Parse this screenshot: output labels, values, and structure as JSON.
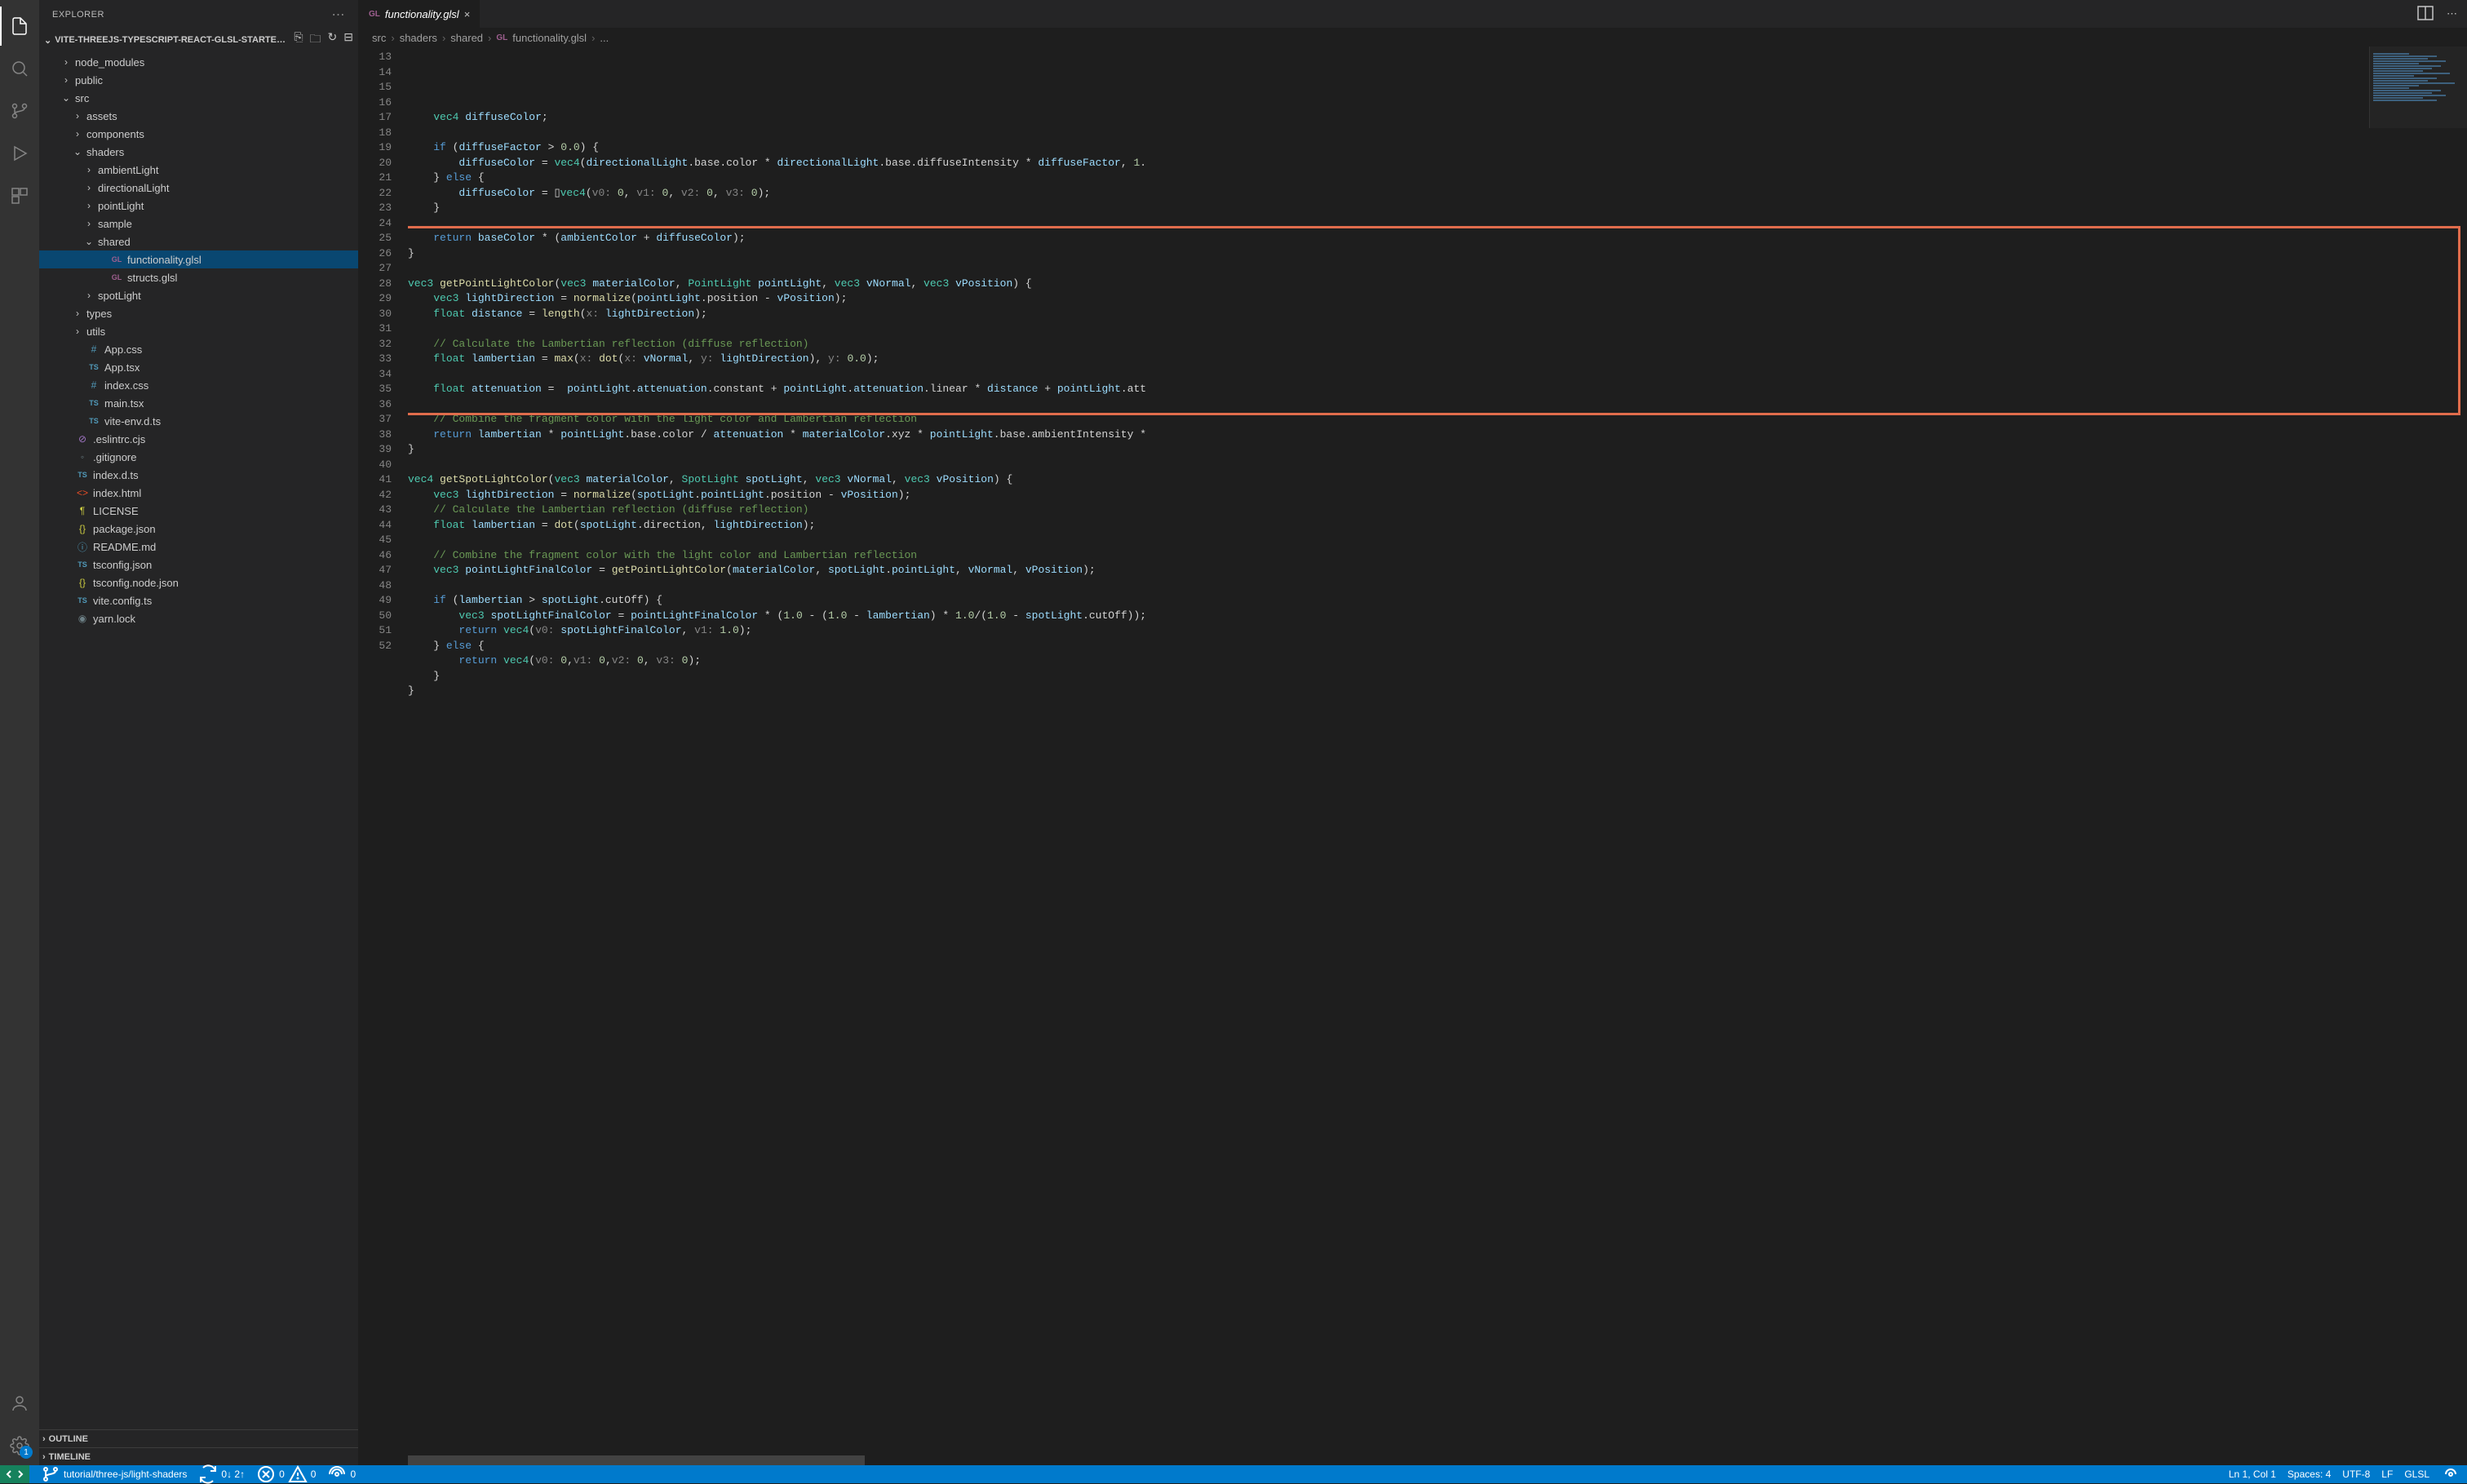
{
  "sidebar": {
    "title": "EXPLORER",
    "project": "VITE-THREEJS-TYPESCRIPT-REACT-GLSL-STARTER-...",
    "outline": "OUTLINE",
    "timeline": "TIMELINE"
  },
  "tree": [
    {
      "depth": 1,
      "chev": "›",
      "icon": "",
      "label": "node_modules",
      "kind": "folder"
    },
    {
      "depth": 1,
      "chev": "›",
      "icon": "",
      "label": "public",
      "kind": "folder"
    },
    {
      "depth": 1,
      "chev": "⌄",
      "icon": "",
      "label": "src",
      "kind": "folder"
    },
    {
      "depth": 2,
      "chev": "›",
      "icon": "",
      "label": "assets",
      "kind": "folder"
    },
    {
      "depth": 2,
      "chev": "›",
      "icon": "",
      "label": "components",
      "kind": "folder"
    },
    {
      "depth": 2,
      "chev": "⌄",
      "icon": "",
      "label": "shaders",
      "kind": "folder"
    },
    {
      "depth": 3,
      "chev": "›",
      "icon": "",
      "label": "ambientLight",
      "kind": "folder"
    },
    {
      "depth": 3,
      "chev": "›",
      "icon": "",
      "label": "directionalLight",
      "kind": "folder"
    },
    {
      "depth": 3,
      "chev": "›",
      "icon": "",
      "label": "pointLight",
      "kind": "folder"
    },
    {
      "depth": 3,
      "chev": "›",
      "icon": "",
      "label": "sample",
      "kind": "folder"
    },
    {
      "depth": 3,
      "chev": "⌄",
      "icon": "",
      "label": "shared",
      "kind": "folder"
    },
    {
      "depth": 4,
      "chev": "",
      "icon": "GL",
      "label": "functionality.glsl",
      "kind": "file",
      "selected": true
    },
    {
      "depth": 4,
      "chev": "",
      "icon": "GL",
      "label": "structs.glsl",
      "kind": "file"
    },
    {
      "depth": 3,
      "chev": "›",
      "icon": "",
      "label": "spotLight",
      "kind": "folder"
    },
    {
      "depth": 2,
      "chev": "›",
      "icon": "",
      "label": "types",
      "kind": "folder"
    },
    {
      "depth": 2,
      "chev": "›",
      "icon": "",
      "label": "utils",
      "kind": "folder"
    },
    {
      "depth": 2,
      "chev": "",
      "icon": "#",
      "label": "App.css",
      "kind": "file"
    },
    {
      "depth": 2,
      "chev": "",
      "icon": "TS",
      "label": "App.tsx",
      "kind": "file"
    },
    {
      "depth": 2,
      "chev": "",
      "icon": "#",
      "label": "index.css",
      "kind": "file"
    },
    {
      "depth": 2,
      "chev": "",
      "icon": "TS",
      "label": "main.tsx",
      "kind": "file"
    },
    {
      "depth": 2,
      "chev": "",
      "icon": "TS",
      "label": "vite-env.d.ts",
      "kind": "file"
    },
    {
      "depth": 1,
      "chev": "",
      "icon": "⊘",
      "label": ".eslintrc.cjs",
      "kind": "file"
    },
    {
      "depth": 1,
      "chev": "",
      "icon": "◦",
      "label": ".gitignore",
      "kind": "file"
    },
    {
      "depth": 1,
      "chev": "",
      "icon": "TS",
      "label": "index.d.ts",
      "kind": "file"
    },
    {
      "depth": 1,
      "chev": "",
      "icon": "<>",
      "label": "index.html",
      "kind": "file"
    },
    {
      "depth": 1,
      "chev": "",
      "icon": "¶",
      "label": "LICENSE",
      "kind": "file"
    },
    {
      "depth": 1,
      "chev": "",
      "icon": "{}",
      "label": "package.json",
      "kind": "file"
    },
    {
      "depth": 1,
      "chev": "",
      "icon": "ⓘ",
      "label": "README.md",
      "kind": "file"
    },
    {
      "depth": 1,
      "chev": "",
      "icon": "TS",
      "label": "tsconfig.json",
      "kind": "file"
    },
    {
      "depth": 1,
      "chev": "",
      "icon": "{}",
      "label": "tsconfig.node.json",
      "kind": "file"
    },
    {
      "depth": 1,
      "chev": "",
      "icon": "TS",
      "label": "vite.config.ts",
      "kind": "file"
    },
    {
      "depth": 1,
      "chev": "",
      "icon": "◉",
      "label": "yarn.lock",
      "kind": "file"
    }
  ],
  "tab": {
    "lang": "GL",
    "name": "functionality.glsl"
  },
  "breadcrumb": [
    "src",
    "shaders",
    "shared",
    "functionality.glsl",
    "..."
  ],
  "breadcrumbFileLang": "GL",
  "code": {
    "startLine": 13,
    "highlightStartLine": 25,
    "highlightEndLine": 36,
    "lines": [
      "",
      "    vec4 diffuseColor;",
      "",
      "    if (diffuseFactor > 0.0) {",
      "        diffuseColor = vec4(directionalLight.base.color * directionalLight.base.diffuseIntensity * diffuseFactor, 1.",
      "    } else {",
      "        diffuseColor = ▯vec4(v0: 0, v1: 0, v2: 0, v3: 0);",
      "    }",
      "",
      "    return baseColor * (ambientColor + diffuseColor);",
      "}",
      "",
      "vec3 getPointLightColor(vec3 materialColor, PointLight pointLight, vec3 vNormal, vec3 vPosition) {",
      "    vec3 lightDirection = normalize(pointLight.position - vPosition);",
      "    float distance = length(x: lightDirection);",
      "",
      "    // Calculate the Lambertian reflection (diffuse reflection)",
      "    float lambertian = max(x: dot(x: vNormal, y: lightDirection), y: 0.0);",
      "",
      "    float attenuation =  pointLight.attenuation.constant + pointLight.attenuation.linear * distance + pointLight.att",
      "",
      "    // Combine the fragment color with the light color and Lambertian reflection",
      "    return lambertian * pointLight.base.color / attenuation * materialColor.xyz * pointLight.base.ambientIntensity *",
      "}",
      "",
      "vec4 getSpotLightColor(vec3 materialColor, SpotLight spotLight, vec3 vNormal, vec3 vPosition) {",
      "    vec3 lightDirection = normalize(spotLight.pointLight.position - vPosition);",
      "    // Calculate the Lambertian reflection (diffuse reflection)",
      "    float lambertian = dot(spotLight.direction, lightDirection);",
      "",
      "    // Combine the fragment color with the light color and Lambertian reflection",
      "    vec3 pointLightFinalColor = getPointLightColor(materialColor, spotLight.pointLight, vNormal, vPosition);",
      "",
      "    if (lambertian > spotLight.cutOff) {",
      "        vec3 spotLightFinalColor = pointLightFinalColor * (1.0 - (1.0 - lambertian) * 1.0/(1.0 - spotLight.cutOff));",
      "        return vec4(v0: spotLightFinalColor, v1: 1.0);",
      "    } else {",
      "        return vec4(v0: 0,v1: 0,v2: 0, v3: 0);",
      "    }",
      "}"
    ]
  },
  "status": {
    "branch": "tutorial/three-js/light-shaders",
    "sync": "0↓ 2↑",
    "errors": "0",
    "warnings": "0",
    "radio": "0",
    "cursor": "Ln 1, Col 1",
    "spaces": "Spaces: 4",
    "encoding": "UTF-8",
    "eol": "LF",
    "lang": "GLSL"
  },
  "icons": {
    "iconColors": {
      "GL": "#9e5f8f",
      "TS": "#519aba",
      "#": "#519aba",
      "{}": "#cbcb41",
      "<>": "#e34c26",
      "ⓘ": "#519aba",
      "¶": "#cbcb41",
      "⊘": "#a074c4",
      "◦": "#6d8086",
      "◉": "#6d8086"
    }
  }
}
